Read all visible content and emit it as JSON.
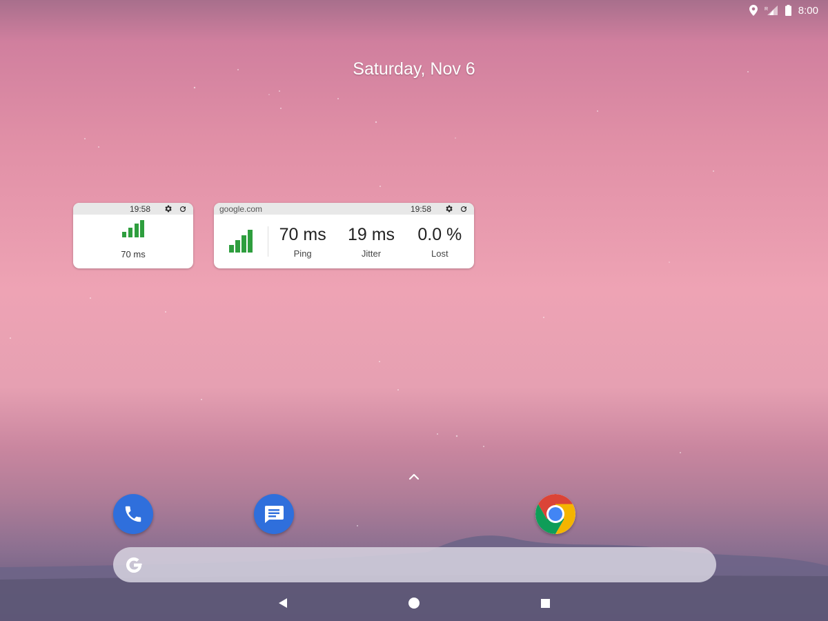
{
  "status_bar": {
    "time": "8:00",
    "icons": [
      "location-icon",
      "signal-icon",
      "battery-icon"
    ]
  },
  "date": "Saturday, Nov 6",
  "widget_small": {
    "time": "19:58",
    "ping": "70 ms"
  },
  "widget_large": {
    "host": "google.com",
    "time": "19:58",
    "ping": {
      "value": "70 ms",
      "label": "Ping"
    },
    "jitter": {
      "value": "19 ms",
      "label": "Jitter"
    },
    "lost": {
      "value": "0.0 %",
      "label": "Lost"
    }
  },
  "dock": [
    "phone-icon",
    "messages-icon",
    "chrome-icon"
  ],
  "colors": {
    "signal_green": "#2e9e3e",
    "app_blue": "#2f6fdc"
  }
}
